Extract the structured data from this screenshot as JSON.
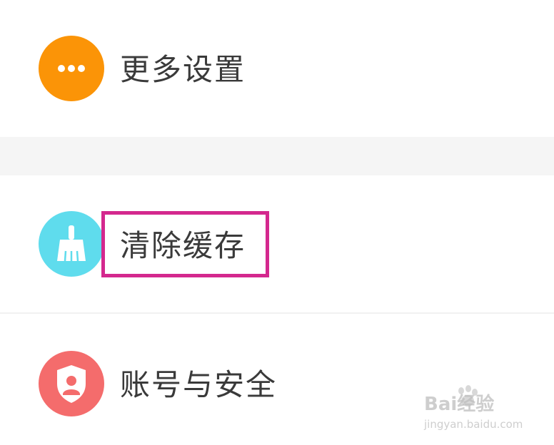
{
  "settings": {
    "items": [
      {
        "label": "更多设置",
        "icon": "more-dots-icon",
        "color": "#fb9407"
      },
      {
        "label": "清除缓存",
        "icon": "broom-icon",
        "color": "#5fdced",
        "highlighted": true
      },
      {
        "label": "账号与安全",
        "icon": "shield-user-icon",
        "color": "#f46c6c"
      }
    ],
    "highlight_color": "#d4288e"
  },
  "watermark": {
    "brand": "Bai经验",
    "url": "jingyan.baidu.com"
  }
}
